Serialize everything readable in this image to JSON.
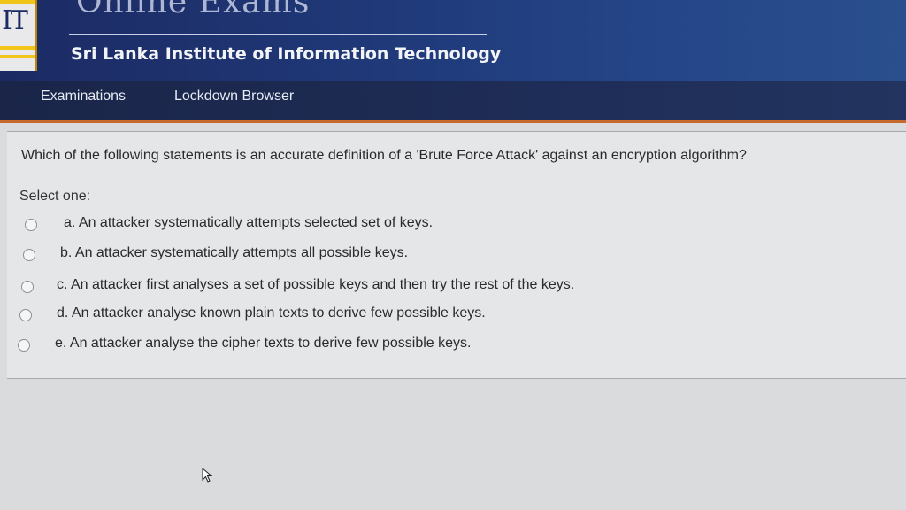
{
  "header": {
    "logo_text": "IT",
    "app_title": "Online Exams",
    "institute": "Sri Lanka Institute of Information Technology"
  },
  "nav": {
    "items": [
      {
        "label": "Examinations"
      },
      {
        "label": "Lockdown Browser"
      }
    ]
  },
  "question": {
    "text": "Which of the following statements is an accurate definition of a 'Brute Force Attack' against an encryption algorithm?",
    "prompt": "Select one:",
    "options": [
      {
        "label": "a. An attacker systematically attempts selected set of keys."
      },
      {
        "label": "b. An attacker systematically attempts all possible keys."
      },
      {
        "label": "c. An attacker first analyses a set of possible keys and then try the rest of the keys."
      },
      {
        "label": "d. An attacker analyse known plain texts to derive few possible keys."
      },
      {
        "label": "e. An attacker analyse the cipher texts to derive few possible keys."
      }
    ]
  }
}
